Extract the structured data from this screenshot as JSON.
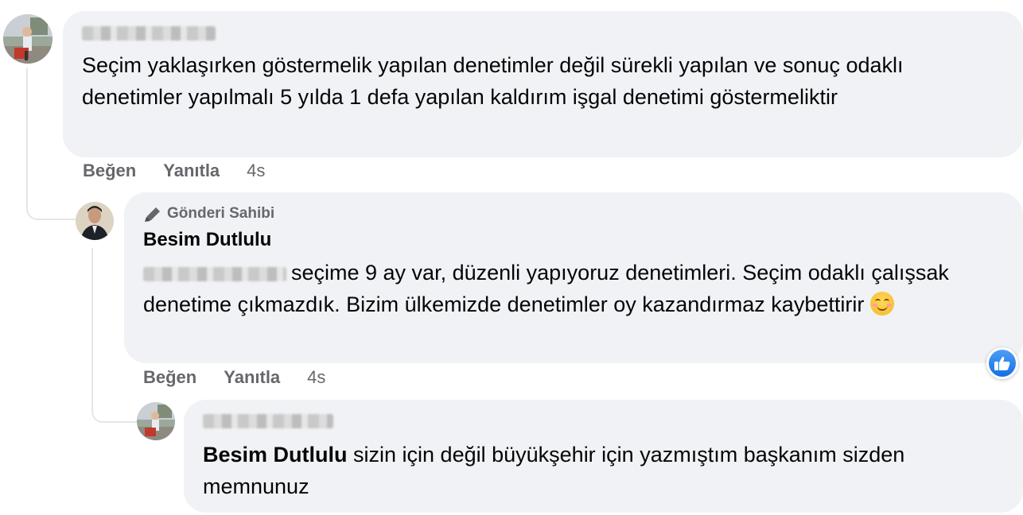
{
  "comments": [
    {
      "text": "Seçim yaklaşırken göstermelik yapılan denetimler değil sürekli yapılan ve sonuç odaklı denetimler yapılmalı 5 yılda 1 defa yapılan kaldırım işgal denetimi göstermeliktir",
      "actions": {
        "like": "Beğen",
        "reply": "Yanıtla",
        "time": "4s"
      }
    },
    {
      "badge": "Gönderi Sahibi",
      "author": "Besim Dutlulu",
      "text": "seçime 9 ay var, düzenli yapıyoruz denetimleri. Seçim odaklı çalışsak denetime çıkmazdık. Bizim ülkemizde denetimler oy kazandırmaz kaybettirir",
      "actions": {
        "like": "Beğen",
        "reply": "Yanıtla",
        "time": "4s"
      }
    },
    {
      "mention": "Besim Dutlulu",
      "text": "sizin için değil büyükşehir için yazmıştım başkanım sizden memnunuz"
    }
  ],
  "colors": {
    "bubble": "#f0f2f5",
    "meta": "#65676b",
    "like_blue": "#1877f2"
  },
  "icons": {
    "badge": "pen-icon",
    "reaction": "thumbs-up-icon",
    "emoji": "smiling-face-emoji"
  }
}
